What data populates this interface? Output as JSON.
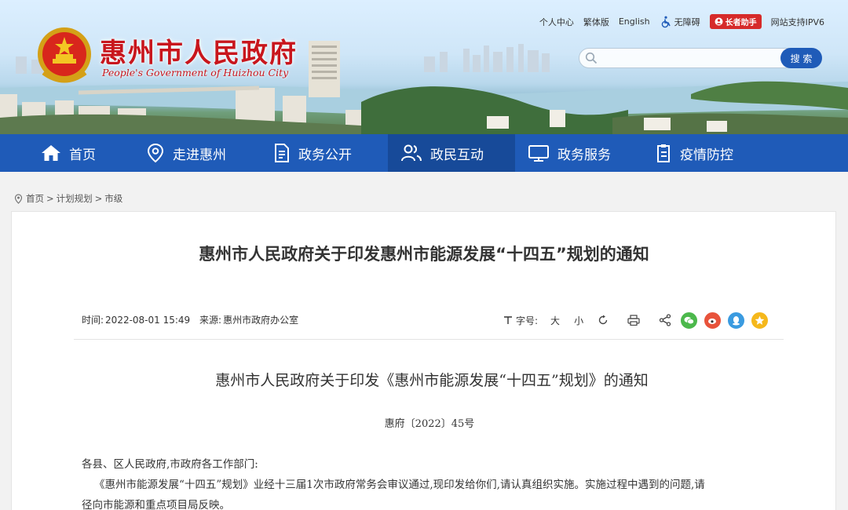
{
  "header": {
    "site_title": "惠州市人民政府",
    "site_subtitle": "People's Government of Huizhou City",
    "top_links": {
      "personal": "个人中心",
      "traditional": "繁体版",
      "english": "English",
      "accessibility": "无障碍",
      "elder": "长者助手",
      "ipv6": "网站支持IPV6"
    },
    "search": {
      "placeholder": "",
      "button": "搜 索"
    }
  },
  "nav": {
    "items": [
      {
        "label": "首页",
        "icon": "home-icon"
      },
      {
        "label": "走进惠州",
        "icon": "location-pin-icon"
      },
      {
        "label": "政务公开",
        "icon": "document-icon"
      },
      {
        "label": "政民互动",
        "icon": "people-icon",
        "active": true
      },
      {
        "label": "政务服务",
        "icon": "monitor-icon"
      },
      {
        "label": "疫情防控",
        "icon": "clipboard-icon"
      }
    ]
  },
  "breadcrumb": {
    "home": "首页",
    "sep": ">",
    "level1": "计划规划",
    "level2": "市级"
  },
  "article": {
    "title": "惠州市人民政府关于印发惠州市能源发展“十四五”规划的通知",
    "time_label": "时间:",
    "time": "2022-08-01 15:49",
    "source_label": "来源:",
    "source": "惠州市政府办公室",
    "font_size_label": "字号:",
    "font_large": "大",
    "font_small": "小",
    "doc_title": "惠州市人民政府关于印发《惠州市能源发展“十四五”规划》的通知",
    "doc_number": "惠府〔2022〕45号",
    "salutation": "各县、区人民政府,市政府各工作部门:",
    "body_line1": "《惠州市能源发展“十四五”规划》业经十三届1次市政府常务会审议通过,现印发给你们,请认真组织实施。实施过程中遇到的问题,请",
    "body_line2": "径向市能源和重点项目局反映。"
  },
  "colors": {
    "brand_red": "#c8161d",
    "nav_blue": "#1f5bb8",
    "nav_active": "#174a99"
  }
}
